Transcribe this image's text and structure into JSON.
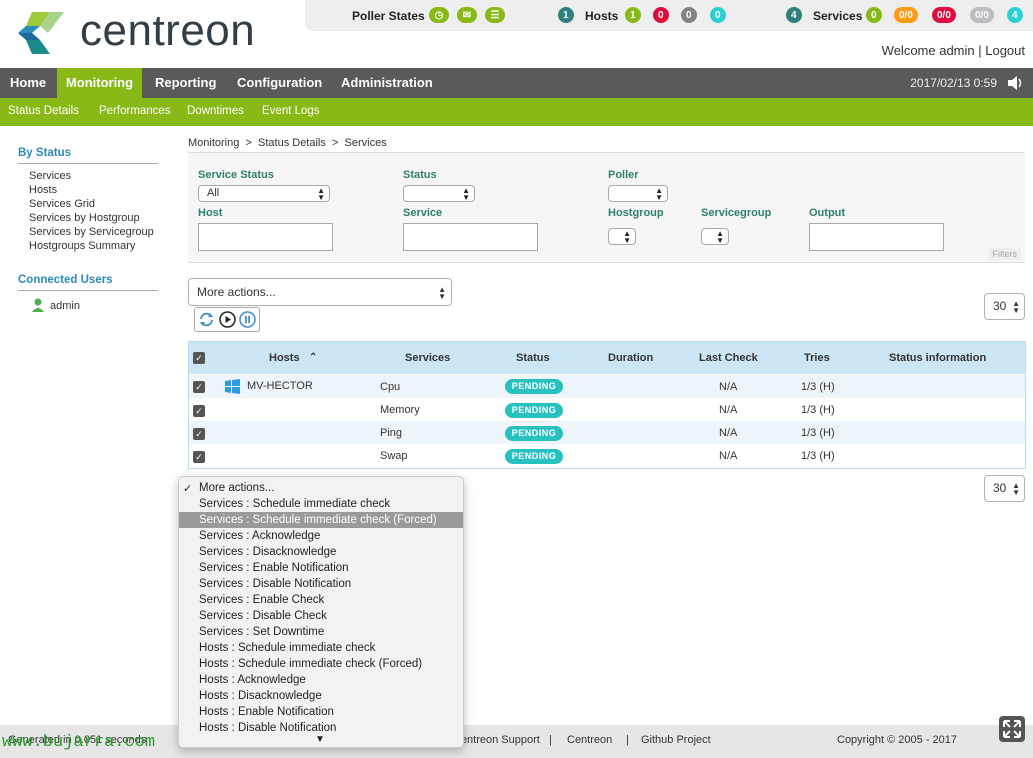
{
  "brand": {
    "name": "centreon"
  },
  "topbar": {
    "poller_label": "Poller States",
    "hosts_label": "Hosts",
    "hosts_total": "1",
    "hosts_counts": [
      "1",
      "0",
      "0",
      "0"
    ],
    "services_label": "Services",
    "services_total": "4",
    "services_counts": [
      "0",
      "0/0",
      "0/0",
      "0/0",
      "4"
    ]
  },
  "user": {
    "welcome": "Welcome admin | Logout"
  },
  "nav": {
    "items": [
      "Home",
      "Monitoring",
      "Reporting",
      "Configuration",
      "Administration"
    ],
    "active": "Monitoring"
  },
  "datetime": "2017/02/13 0:59",
  "subnav": {
    "items": [
      "Status Details",
      "Performances",
      "Downtimes",
      "Event Logs"
    ]
  },
  "sidebar": {
    "by_status_title": "By Status",
    "links": [
      "Services",
      "Hosts",
      "Services Grid",
      "Services by Hostgroup",
      "Services by Servicegroup",
      "Hostgroups Summary"
    ],
    "connected_title": "Connected Users",
    "connected_user": "admin"
  },
  "breadcrumb": "Monitoring  >  Status Details  >  Services",
  "filters": {
    "service_status_label": "Service Status",
    "service_status_value": "All",
    "status_label": "Status",
    "poller_label": "Poller",
    "host_label": "Host",
    "service_label": "Service",
    "hostgroup_label": "Hostgroup",
    "servicegroup_label": "Servicegroup",
    "output_label": "Output",
    "filters_tag": "Filters"
  },
  "actions": {
    "select_value": "More actions...",
    "page_size": "30"
  },
  "table": {
    "headers": [
      "Hosts",
      "Services",
      "Status",
      "Duration",
      "Last Check",
      "Tries",
      "Status information"
    ],
    "rows": [
      {
        "host": "MV-HECTOR",
        "service": "Cpu",
        "status": "PENDING",
        "last_check": "N/A",
        "tries": "1/3 (H)"
      },
      {
        "host": "",
        "service": "Memory",
        "status": "PENDING",
        "last_check": "N/A",
        "tries": "1/3 (H)"
      },
      {
        "host": "",
        "service": "Ping",
        "status": "PENDING",
        "last_check": "N/A",
        "tries": "1/3 (H)"
      },
      {
        "host": "",
        "service": "Swap",
        "status": "PENDING",
        "last_check": "N/A",
        "tries": "1/3 (H)"
      }
    ]
  },
  "dropdown": {
    "checked_item": "More actions...",
    "highlighted_item": "Services : Schedule immediate check (Forced)",
    "items": [
      "More actions...",
      "Services : Schedule immediate check",
      "Services : Schedule immediate check (Forced)",
      "Services : Acknowledge",
      "Services : Disacknowledge",
      "Services : Enable Notification",
      "Services : Disable Notification",
      "Services : Enable Check",
      "Services : Disable Check",
      "Services : Set Downtime",
      "Hosts : Schedule immediate check",
      "Hosts : Schedule immediate check (Forced)",
      "Hosts : Acknowledge",
      "Hosts : Disacknowledge",
      "Hosts : Enable Notification",
      "Hosts : Disable Notification"
    ]
  },
  "footer": {
    "generated": "Generated in 0.051 seconds",
    "links": [
      "Centreon Support",
      "|",
      "Centreon",
      "|",
      "Github Project"
    ],
    "copyright": "Copyright © 2005 - 2017",
    "watermark": "www.bujarra.com"
  },
  "colors": {
    "green": "#88b917",
    "nav_gray": "#5a5a5a",
    "pending": "#29c0c0",
    "header_blue": "#cde6f5"
  }
}
